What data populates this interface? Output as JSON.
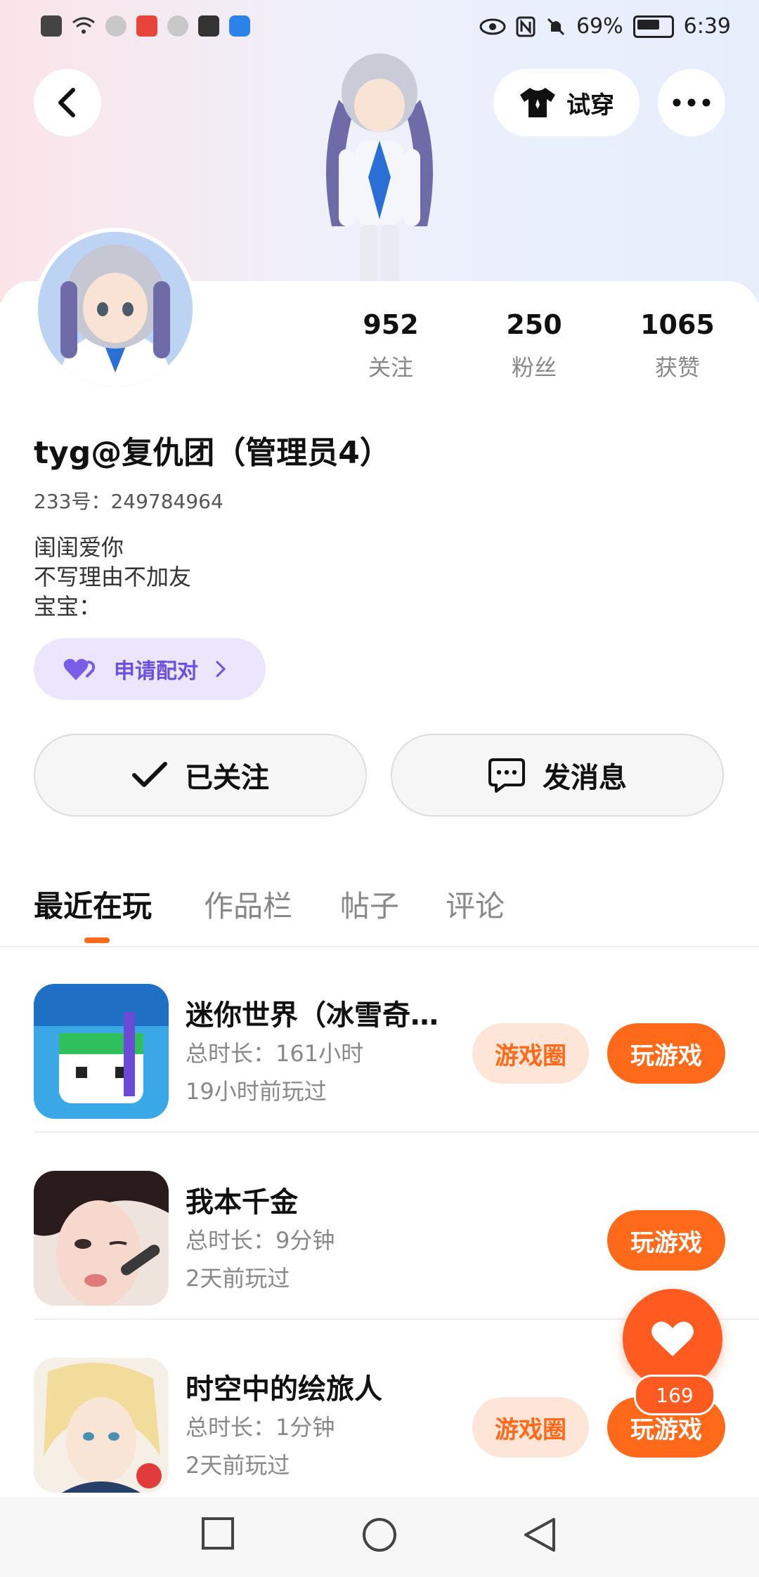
{
  "status_bar": {
    "battery": "69%",
    "time": "6:39"
  },
  "header": {
    "tryon_label": "试穿"
  },
  "profile": {
    "stats": [
      {
        "value": "952",
        "label": "关注"
      },
      {
        "value": "250",
        "label": "粉丝"
      },
      {
        "value": "1065",
        "label": "获赞"
      }
    ],
    "username": "tyg@复仇团（管理员4）",
    "uid_label": "233号：",
    "uid_value": "249784964",
    "bio": [
      "闺闺爱你",
      "不写理由不加友",
      "宝宝："
    ],
    "pair_label": "申请配对"
  },
  "actions": {
    "follow_label": "已关注",
    "message_label": "发消息"
  },
  "tabs": [
    "最近在玩",
    "作品栏",
    "帖子",
    "评论"
  ],
  "games": [
    {
      "name": "迷你世界（冰雪奇…",
      "duration": "总时长：161小时",
      "last_played": "19小时前玩过",
      "circle_label": "游戏圈",
      "play_label": "玩游戏"
    },
    {
      "name": "我本千金",
      "duration": "总时长：9分钟",
      "last_played": "2天前玩过",
      "circle_label": "",
      "play_label": "玩游戏"
    },
    {
      "name": "时空中的绘旅人",
      "duration": "总时长：1分钟",
      "last_played": "2天前玩过",
      "circle_label": "游戏圈",
      "play_label": "玩游戏"
    }
  ],
  "fab": {
    "count": "169"
  },
  "colors": {
    "accent": "#ff6a1a",
    "pair": "#6a4fe0"
  }
}
